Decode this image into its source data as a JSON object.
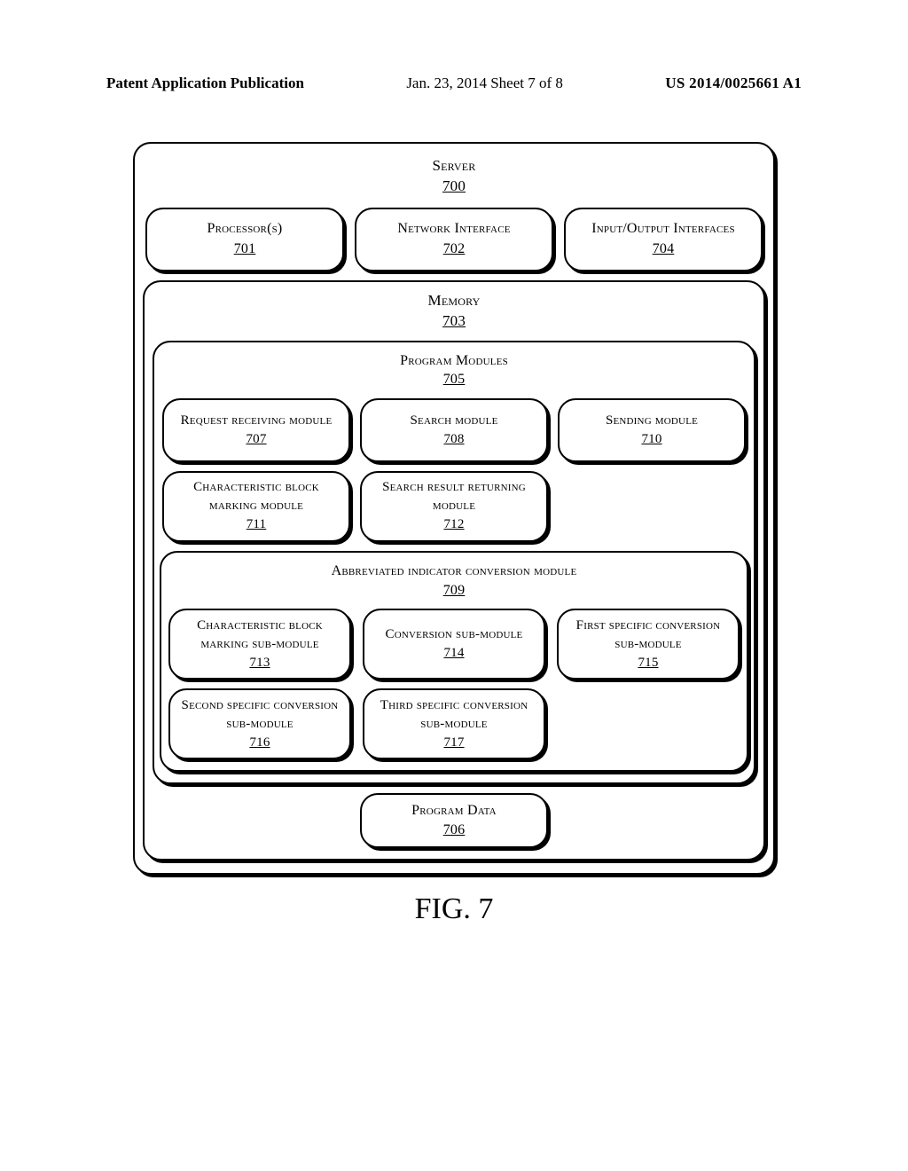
{
  "header": {
    "left": "Patent Application Publication",
    "center": "Jan. 23, 2014  Sheet 7 of 8",
    "right": "US 2014/0025661 A1"
  },
  "server": {
    "title": "Server",
    "num": "700"
  },
  "top_row": [
    {
      "title": "Processor(s)",
      "num": "701"
    },
    {
      "title": "Network Interface",
      "num": "702"
    },
    {
      "title": "Input/Output Interfaces",
      "num": "704"
    }
  ],
  "memory": {
    "title": "Memory",
    "num": "703"
  },
  "programs": {
    "title": "Program Modules",
    "num": "705"
  },
  "mod_row1": [
    {
      "title": "Request receiving module",
      "num": "707"
    },
    {
      "title": "Search module",
      "num": "708"
    },
    {
      "title": "Sending module",
      "num": "710"
    }
  ],
  "mod_row2": [
    {
      "title": "Characteristic block marking module",
      "num": "711"
    },
    {
      "title": "Search result returning module",
      "num": "712"
    }
  ],
  "convmod": {
    "title": "Abbreviated indicator conversion module",
    "num": "709"
  },
  "conv_row1": [
    {
      "title": "Characteristic block marking sub-module",
      "num": "713"
    },
    {
      "title": "Conversion sub-module",
      "num": "714"
    },
    {
      "title": "First specific conversion sub-module",
      "num": "715"
    }
  ],
  "conv_row2": [
    {
      "title": "Second specific conversion sub-module",
      "num": "716"
    },
    {
      "title": "Third specific conversion sub-module",
      "num": "717"
    }
  ],
  "program_data": {
    "title": "Program Data",
    "num": "706"
  },
  "figure_caption": "FIG. 7"
}
